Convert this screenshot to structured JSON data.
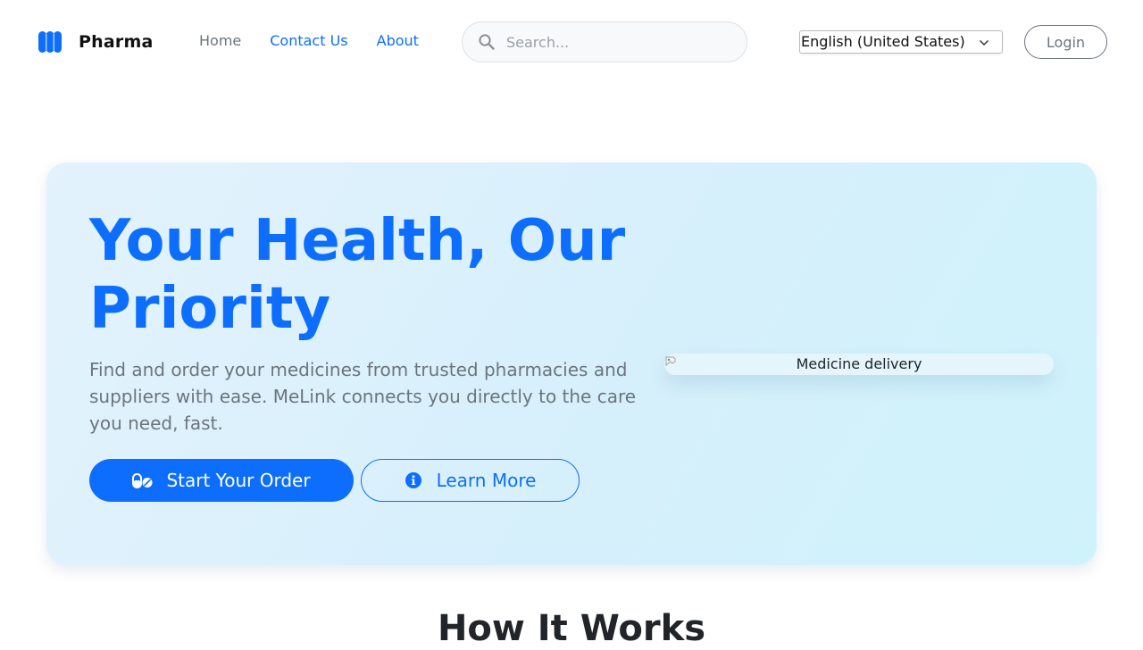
{
  "brand": {
    "name": "Pharma",
    "logo_color": "#0d6efd",
    "logo_icon": "medical-logo-icon"
  },
  "nav": {
    "items": [
      {
        "label": "Home"
      },
      {
        "label": "Contact Us"
      },
      {
        "label": "About"
      }
    ]
  },
  "search": {
    "placeholder": "Search...",
    "value": "",
    "icon": "search-icon"
  },
  "language": {
    "selected": "English (United States)",
    "icon": "chevron-down-icon"
  },
  "auth": {
    "login_label": "Login"
  },
  "hero": {
    "title": "Your Health, Our Priority",
    "text": "Find and order your medicines from trusted pharmacies and suppliers with ease. MeLink connects you directly to the care you need, fast.",
    "primary_button": {
      "label": "Start Your Order",
      "icon": "pills-icon"
    },
    "secondary_button": {
      "label": "Learn More",
      "icon": "info-circle-icon"
    },
    "image_alt": "Medicine delivery"
  },
  "how_it_works": {
    "title": "How It Works"
  },
  "colors": {
    "primary": "#0d6efd",
    "muted": "#6c757d",
    "hero_bg": "#dbf1fc"
  }
}
